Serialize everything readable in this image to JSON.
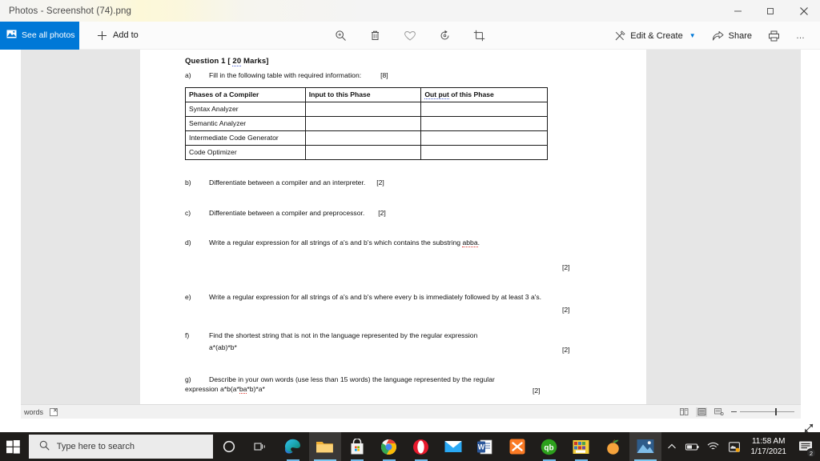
{
  "window": {
    "title": "Photos - Screenshot (74).png",
    "controls": {
      "minimize": "minimize-icon",
      "maximize": "maximize-icon",
      "close": "close-icon"
    }
  },
  "toolbar": {
    "see_all_photos": "See all photos",
    "add_to": "Add to",
    "center_icons": [
      "zoom-icon",
      "delete-icon",
      "favorite-icon",
      "rotate-icon",
      "crop-icon"
    ],
    "edit_create": "Edit & Create",
    "share": "Share",
    "print": "print-icon",
    "more": "…"
  },
  "statusbar": {
    "words_label": "words",
    "zoom_minus": "−",
    "view_icons": [
      "multi-page-view-icon",
      "single-page-view-icon",
      "web-layout-view-icon"
    ]
  },
  "document": {
    "heading_prefix": "Question 1 [ ",
    "heading_marks": "20",
    "heading_suffix": " Marks]",
    "items": [
      {
        "label": "a)",
        "text": "Fill in the following table with required information:",
        "mark": "[8]"
      },
      {
        "label": "b)",
        "text": "Differentiate between a compiler and an interpreter.",
        "mark": "[2]"
      },
      {
        "label": "c)",
        "text": "Differentiate between a compiler and preprocessor.",
        "mark": "[2]"
      },
      {
        "label": "d)",
        "text": "Write a regular expression for all strings of a's and b's which contains the substring ",
        "misspelled": "abba",
        "tail": ".",
        "mark": "[2]"
      },
      {
        "label": "e)",
        "text": "Write a regular expression for all strings of a's and b's where every b is immediately followed by at least 3 a's.",
        "mark": "[2]"
      },
      {
        "label": "f)",
        "text": "Find the shortest string that is not in the language represented by the regular expression",
        "text2": "a*(ab)*b*",
        "mark": "[2]"
      },
      {
        "label": "g)",
        "text": "Describe in your own words (use less than 15 words) the language represented by the regular",
        "text2_pre": "expression a*b(a*",
        "text2_misspelled": "ba",
        "text2_post": "*b)*a*",
        "mark": "[2]"
      }
    ],
    "table": {
      "headers": [
        "Phases of a Compiler",
        "Input to this Phase",
        "Out put of this Phase"
      ],
      "header_misspelled": "Out put",
      "header_misspelled_tail": " of this Phase",
      "rows": [
        [
          "Syntax Analyzer",
          "",
          ""
        ],
        [
          "Semantic Analyzer",
          "",
          ""
        ],
        [
          "Intermediate Code Generator",
          "",
          ""
        ],
        [
          "Code Optimizer",
          "",
          ""
        ]
      ]
    }
  },
  "taskbar": {
    "search_placeholder": "Type here to search",
    "start": "windows-start-icon",
    "items": [
      {
        "name": "cortana-icon"
      },
      {
        "name": "task-view-icon"
      },
      {
        "name": "edge-icon"
      },
      {
        "name": "file-explorer-icon"
      },
      {
        "name": "microsoft-store-icon"
      },
      {
        "name": "chrome-icon"
      },
      {
        "name": "opera-icon"
      },
      {
        "name": "mail-icon"
      },
      {
        "name": "word-icon"
      },
      {
        "name": "xampp-icon"
      },
      {
        "name": "quickbooks-icon"
      },
      {
        "name": "winrar-icon"
      },
      {
        "name": "peach-app-icon"
      },
      {
        "name": "photos-icon"
      }
    ],
    "tray": [
      "show-hidden-icons-chevron",
      "battery-icon",
      "wifi-icon",
      "onedrive-icon"
    ],
    "time": "11:58 AM",
    "date": "1/17/2021",
    "notification_count": "2"
  },
  "colors": {
    "accent": "#0078d7",
    "taskbar": "#1f1d1b",
    "page": "#ffffff",
    "shell_gray": "#e6e6e6",
    "spell_red": "#e03a32",
    "spell_blue": "#4a63d8"
  }
}
